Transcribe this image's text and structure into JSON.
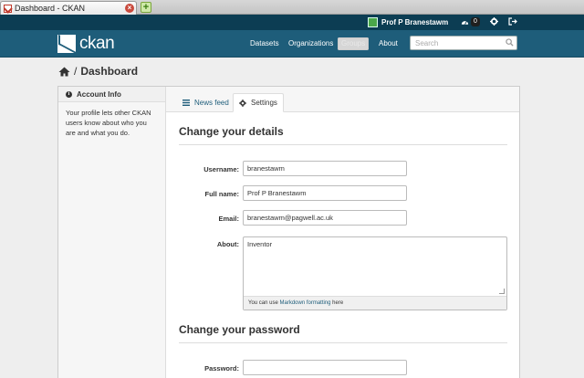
{
  "browser": {
    "tab_title": "Dashboard - CKAN",
    "close_glyph": "×",
    "new_tab_glyph": "+"
  },
  "account": {
    "user_name": "Prof P Branestawm",
    "dashboard_count": "0"
  },
  "masthead": {
    "logo_text": "ckan",
    "nav": [
      "Datasets",
      "Organizations",
      "Groups",
      "About"
    ],
    "active_nav_index": 2,
    "search_placeholder": "Search"
  },
  "breadcrumb": {
    "separator": "/",
    "current": "Dashboard"
  },
  "sidebar": {
    "heading": "Account Info",
    "body": "Your profile lets other CKAN users know about who you are and what you do."
  },
  "tabs": {
    "news_feed": "News feed",
    "settings": "Settings"
  },
  "details": {
    "title": "Change your details",
    "username_label": "Username:",
    "username_value": "branestawm",
    "fullname_label": "Full name:",
    "fullname_value": "Prof P Branestawm",
    "email_label": "Email:",
    "email_value": "branestawm@pagwell.ac.uk",
    "about_label": "About:",
    "about_value": "Inventor",
    "help_prefix": "You can use ",
    "help_link": "Markdown formatting",
    "help_suffix": " here"
  },
  "password": {
    "title": "Change your password",
    "password_label": "Password:",
    "password_value": ""
  },
  "colors": {
    "account_bar": "#0c3d53",
    "masthead": "#1e5d7a",
    "link": "#1e5d7a"
  }
}
